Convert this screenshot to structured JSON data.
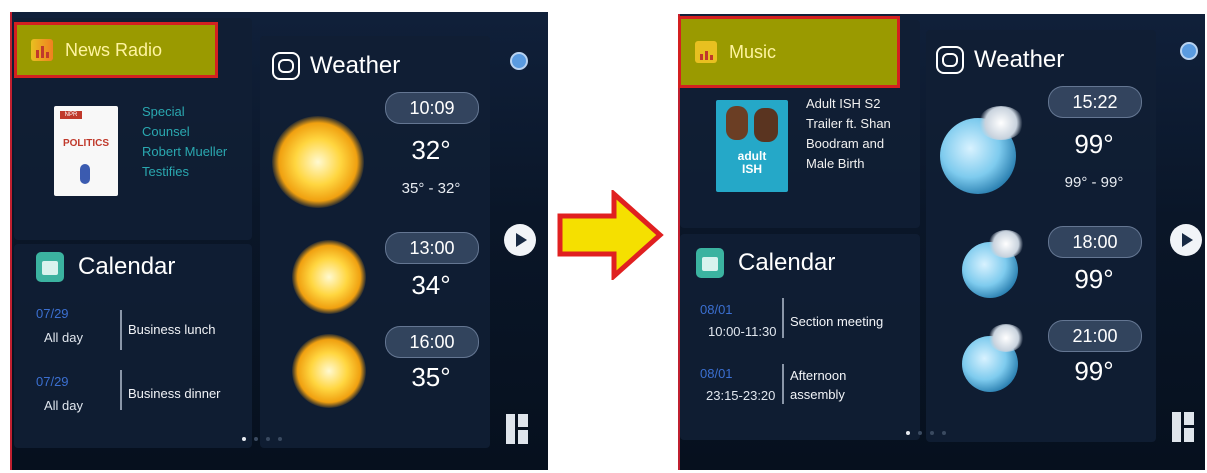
{
  "left": {
    "header_label": "News Radio",
    "media": {
      "art_badge": "NPR",
      "art_title": "POLITICS",
      "lines": [
        "Special",
        "Counsel",
        "Robert Mueller",
        "Testifies"
      ]
    },
    "weather": {
      "title": "Weather",
      "slots": [
        {
          "time": "10:09",
          "temp": "32°",
          "range": "35° - 32°",
          "icon": "sun-icon"
        },
        {
          "time": "13:00",
          "temp": "34°",
          "icon": "sun-icon"
        },
        {
          "time": "16:00",
          "temp": "35°",
          "icon": "sun-icon"
        }
      ]
    },
    "calendar": {
      "title": "Calendar",
      "events": [
        {
          "date": "07/29",
          "time": "All day",
          "title": "Business lunch"
        },
        {
          "date": "07/29",
          "time": "All day",
          "title": "Business dinner"
        }
      ]
    }
  },
  "right": {
    "header_label": "Music",
    "media": {
      "art_text": "adult\nISH",
      "lines": [
        "Adult ISH S2",
        "Trailer ft. Shan",
        "Boodram and",
        "Male Birth"
      ]
    },
    "weather": {
      "title": "Weather",
      "slots": [
        {
          "time": "15:22",
          "temp": "99°",
          "range": "99° - 99°",
          "icon": "moon-cloud-icon"
        },
        {
          "time": "18:00",
          "temp": "99°",
          "icon": "moon-cloud-icon"
        },
        {
          "time": "21:00",
          "temp": "99°",
          "icon": "moon-cloud-icon"
        }
      ]
    },
    "calendar": {
      "title": "Calendar",
      "events": [
        {
          "date": "08/01",
          "time": "10:00-11:30",
          "title": "Section meeting"
        },
        {
          "date": "08/01",
          "time": "23:15-23:20",
          "title": "Afternoon assembly"
        }
      ]
    }
  },
  "colors": {
    "header_highlight": "#9a9a00",
    "header_border": "#d42020",
    "arrow_fill": "#f5e000",
    "arrow_stroke": "#e02020",
    "media_text_left": "#2aa8b0",
    "media_text_right": "#f0f0f0",
    "calendar_date": "#3b6fd0"
  }
}
